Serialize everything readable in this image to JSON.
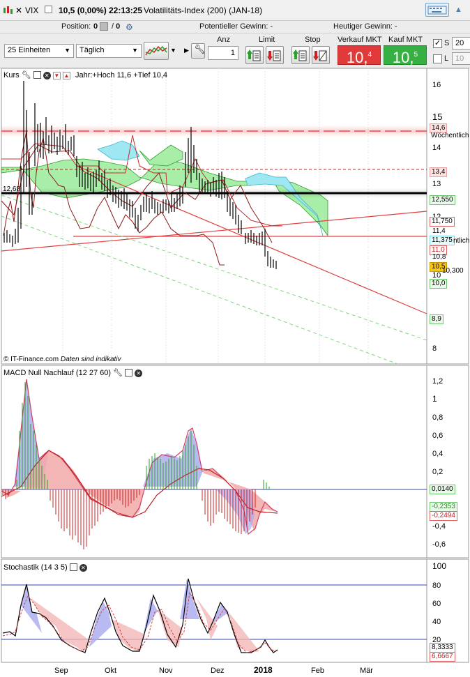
{
  "window": {
    "symbol": "VIX",
    "price_line": "10,5 (0,00%)",
    "time": "22:13:25",
    "instrument": "Volatilitäts-Index (200) (JAN-18)"
  },
  "position_bar": {
    "position_label": "Position:",
    "position_value": "0",
    "position_value2": "0",
    "potential_gain": "Potentieller Gewinn:  -",
    "today_gain": "Heutiger Gewinn:  -"
  },
  "toolbar": {
    "units_select": "25 Einheiten",
    "period_select": "Täglich",
    "anz_label": "Anz",
    "anz_value": "1",
    "limit_label": "Limit",
    "stop_label": "Stop",
    "sell_label": "Verkauf MKT",
    "sell_price": "10,",
    "sell_price_sup": "4",
    "buy_label": "Kauf MKT",
    "buy_price": "10,",
    "buy_price_sup": "5",
    "s_label": "S",
    "s_value": "20",
    "l_label": "L",
    "l_value": "10"
  },
  "price_panel": {
    "title": "Kurs",
    "range_info": "Jahr:+Hoch 11,6 +Tief 10,4",
    "footer": "© IT-Finance.com",
    "footer_note": "Daten sind indikativ",
    "axis_ticks": [
      "16",
      "15",
      "14",
      "13",
      "12",
      "11",
      "10",
      "9",
      "8"
    ],
    "left_level_label": "12,68",
    "labels": {
      "weekly_high": "14,6",
      "weekly_text": "Wöchentlich",
      "level_134": "13,4",
      "level_12550": "12,550",
      "level_11750": "11,750",
      "level_114": "11,4",
      "level_11375": "11,375",
      "level_tlich": "ntlich",
      "level_110": "11,0",
      "level_108": "10,8",
      "level_105": "10,5",
      "level_10300": "10,300",
      "level_100": "10,0",
      "level_89": "8,9"
    }
  },
  "macd_panel": {
    "title": "MACD Null Nachlauf (12 27 60)",
    "axis_ticks": [
      "1,2",
      "1",
      "0,8",
      "0,6",
      "0,4",
      "0,2",
      "-0,4",
      "-0,6"
    ],
    "labels": {
      "v1": "0,0140",
      "v2": "-0,2353",
      "v3": "-0,2494"
    }
  },
  "stoch_panel": {
    "title": "Stochastik (14 3 5)",
    "axis_ticks": [
      "100",
      "80",
      "60",
      "40",
      "20"
    ],
    "labels": {
      "k": "8,3333",
      "d": "6,6667"
    }
  },
  "time_axis": [
    "Sep",
    "Okt",
    "Nov",
    "Dez",
    "2018",
    "Feb",
    "Mär"
  ],
  "colors": {
    "sell": "#e03a3a",
    "buy": "#36b043",
    "ichimoku_green": "#9be89b",
    "ichimoku_cyan": "#8fe3f0",
    "resistance": "#e0303a",
    "support": "#000000"
  }
}
